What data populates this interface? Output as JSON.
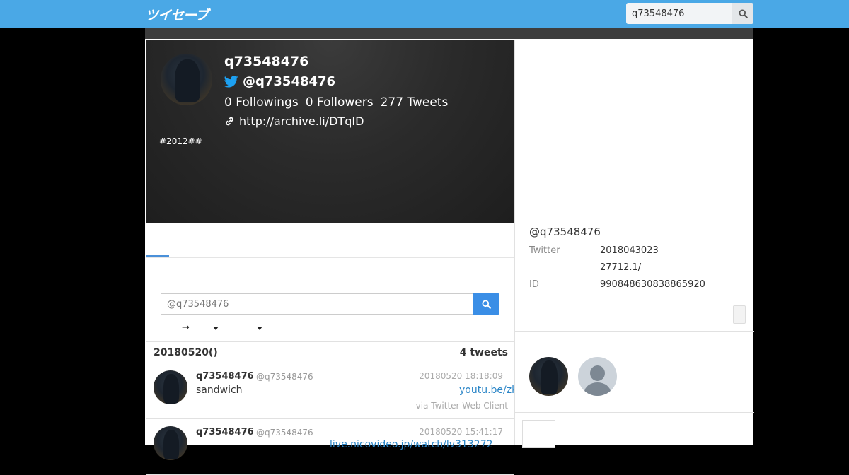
{
  "app": {
    "logo": "ツイセーブ",
    "search_value": "q73548476",
    "brand_color": "#4aa8e6",
    "accent_color": "#3a8ee6"
  },
  "profile": {
    "name": "q73548476",
    "handle": "@q73548476",
    "followings": "0 Followings",
    "followers": "0 Followers",
    "tweets": "277 Tweets",
    "link": "http://archive.li/DTqID",
    "bio": "#2012##"
  },
  "timeline": {
    "search_placeholder": "@q73548476",
    "sort_arrow": "→",
    "day_title": "20180520()",
    "day_count": "4 tweets",
    "tweets": [
      {
        "name": "q73548476",
        "handle": "@q73548476",
        "time": "20180520 18:18:09",
        "text": "sandwich",
        "link": "youtu.be/zk",
        "via": "via Twitter Web Client"
      },
      {
        "name": "q73548476",
        "handle": "@q73548476",
        "time": "20180520 15:41:17",
        "text": "",
        "link": "live.nicovideo.jp/watch/lv313272",
        "via": ""
      }
    ]
  },
  "sidebar": {
    "handle": "@q73548476",
    "rows": [
      {
        "label": "Twitter",
        "value": "2018043023"
      },
      {
        "label": "",
        "value": "27712.1/"
      },
      {
        "label": "ID",
        "value": "990848630838865920"
      }
    ]
  },
  "icons": {
    "search": "search-icon",
    "twitter": "twitter-bird-icon",
    "link": "link-icon",
    "caret": "caret-down-icon"
  }
}
